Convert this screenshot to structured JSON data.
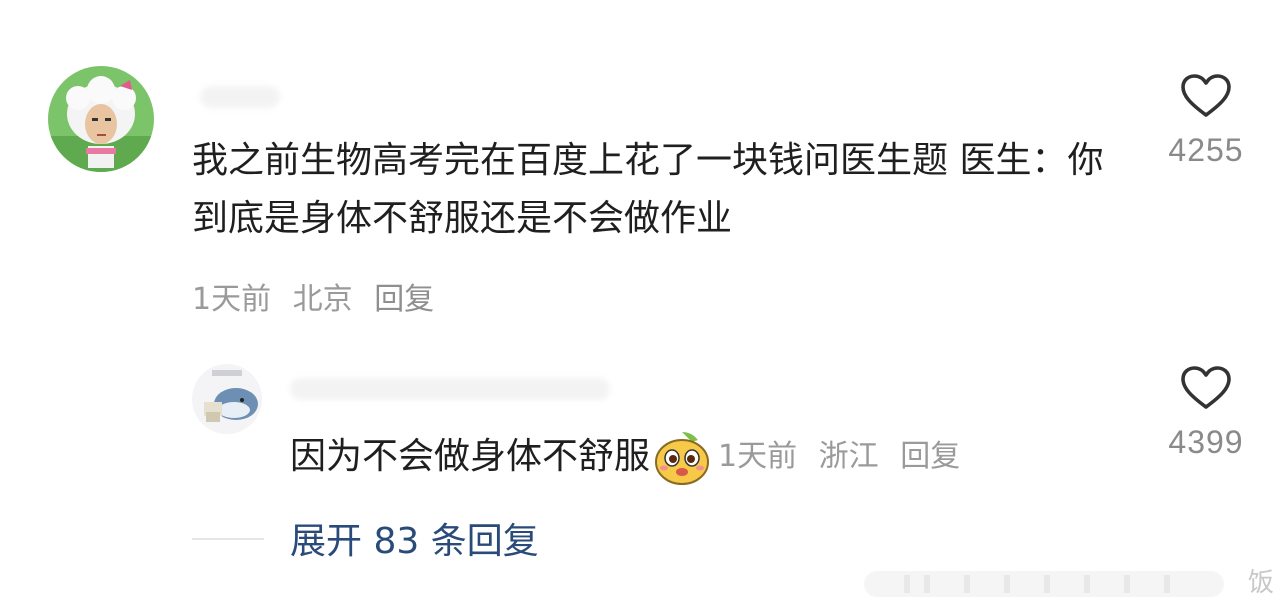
{
  "comment": {
    "text": "我之前生物高考完在百度上花了一块钱问医生题 医生：你到底是身体不舒服还是不会做作业",
    "time": "1天前",
    "location": "北京",
    "reply_label": "回复",
    "like_count": "4255"
  },
  "reply": {
    "text": "因为不会做身体不舒服",
    "time": "1天前",
    "location": "浙江",
    "reply_label": "回复",
    "like_count": "4399"
  },
  "expand": {
    "label": "展开 83 条回复"
  },
  "icons": {
    "like": "heart-outline-icon",
    "emoji": "cute-face-emoji-icon"
  },
  "colors": {
    "link": "#2a4a7a",
    "meta": "#9a9a9a",
    "text": "#1f1f1f"
  },
  "watermark": {
    "char": "饭"
  }
}
